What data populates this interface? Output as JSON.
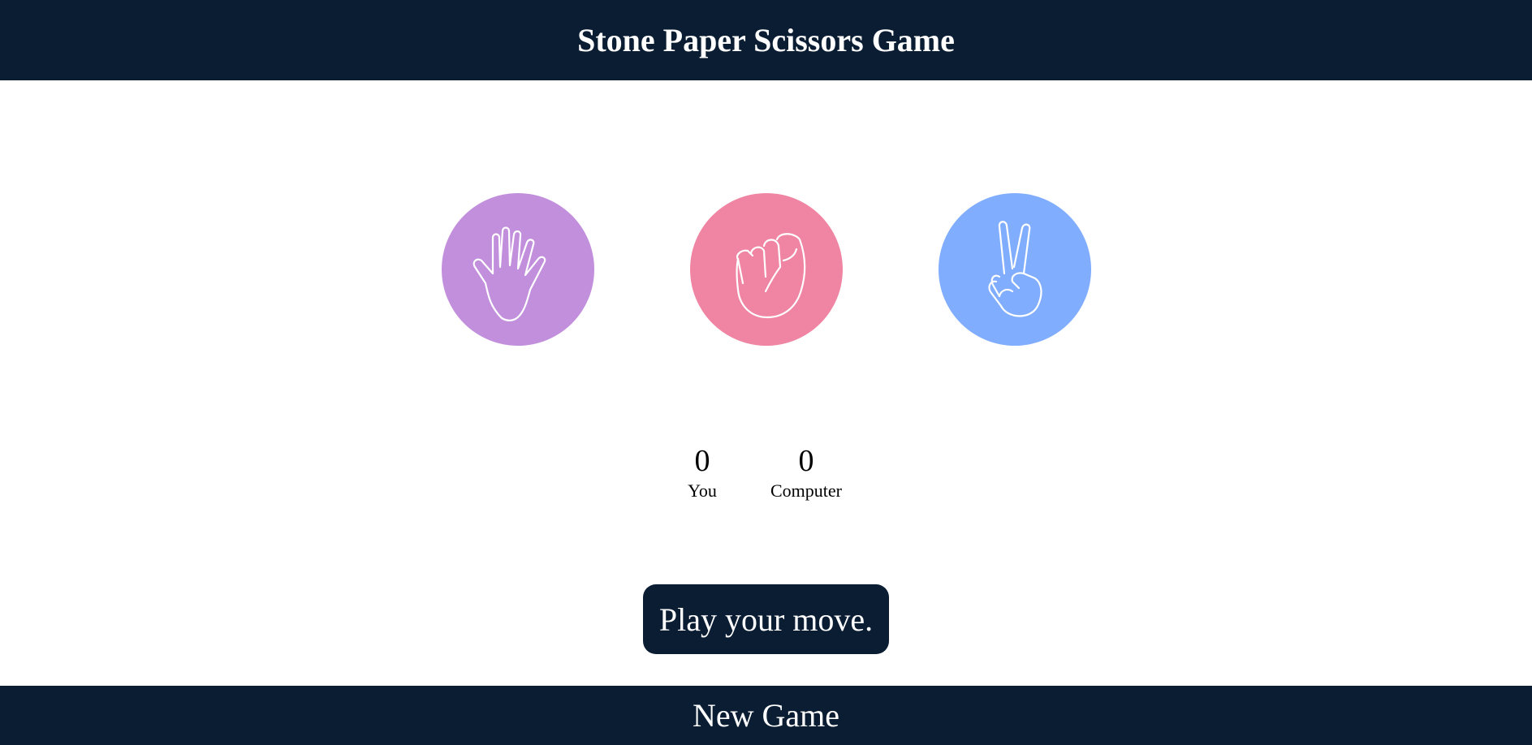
{
  "header": {
    "title": "Stone Paper Scissors Game"
  },
  "choices": [
    {
      "id": "paper",
      "icon": "open-hand-icon",
      "color": "#c28fdc"
    },
    {
      "id": "stone",
      "icon": "fist-icon",
      "color": "#f085a3"
    },
    {
      "id": "scissors",
      "icon": "peace-sign-hand-icon",
      "color": "#80adfd"
    }
  ],
  "score": {
    "user": {
      "value": "0",
      "label": "You"
    },
    "computer": {
      "value": "0",
      "label": "Computer"
    }
  },
  "message": {
    "text": "Play your move."
  },
  "footer": {
    "new_game_label": "New Game"
  },
  "colors": {
    "dark_navy": "#0b1d33",
    "paper": "#c28fdc",
    "stone": "#f085a3",
    "scissors": "#80adfd"
  }
}
